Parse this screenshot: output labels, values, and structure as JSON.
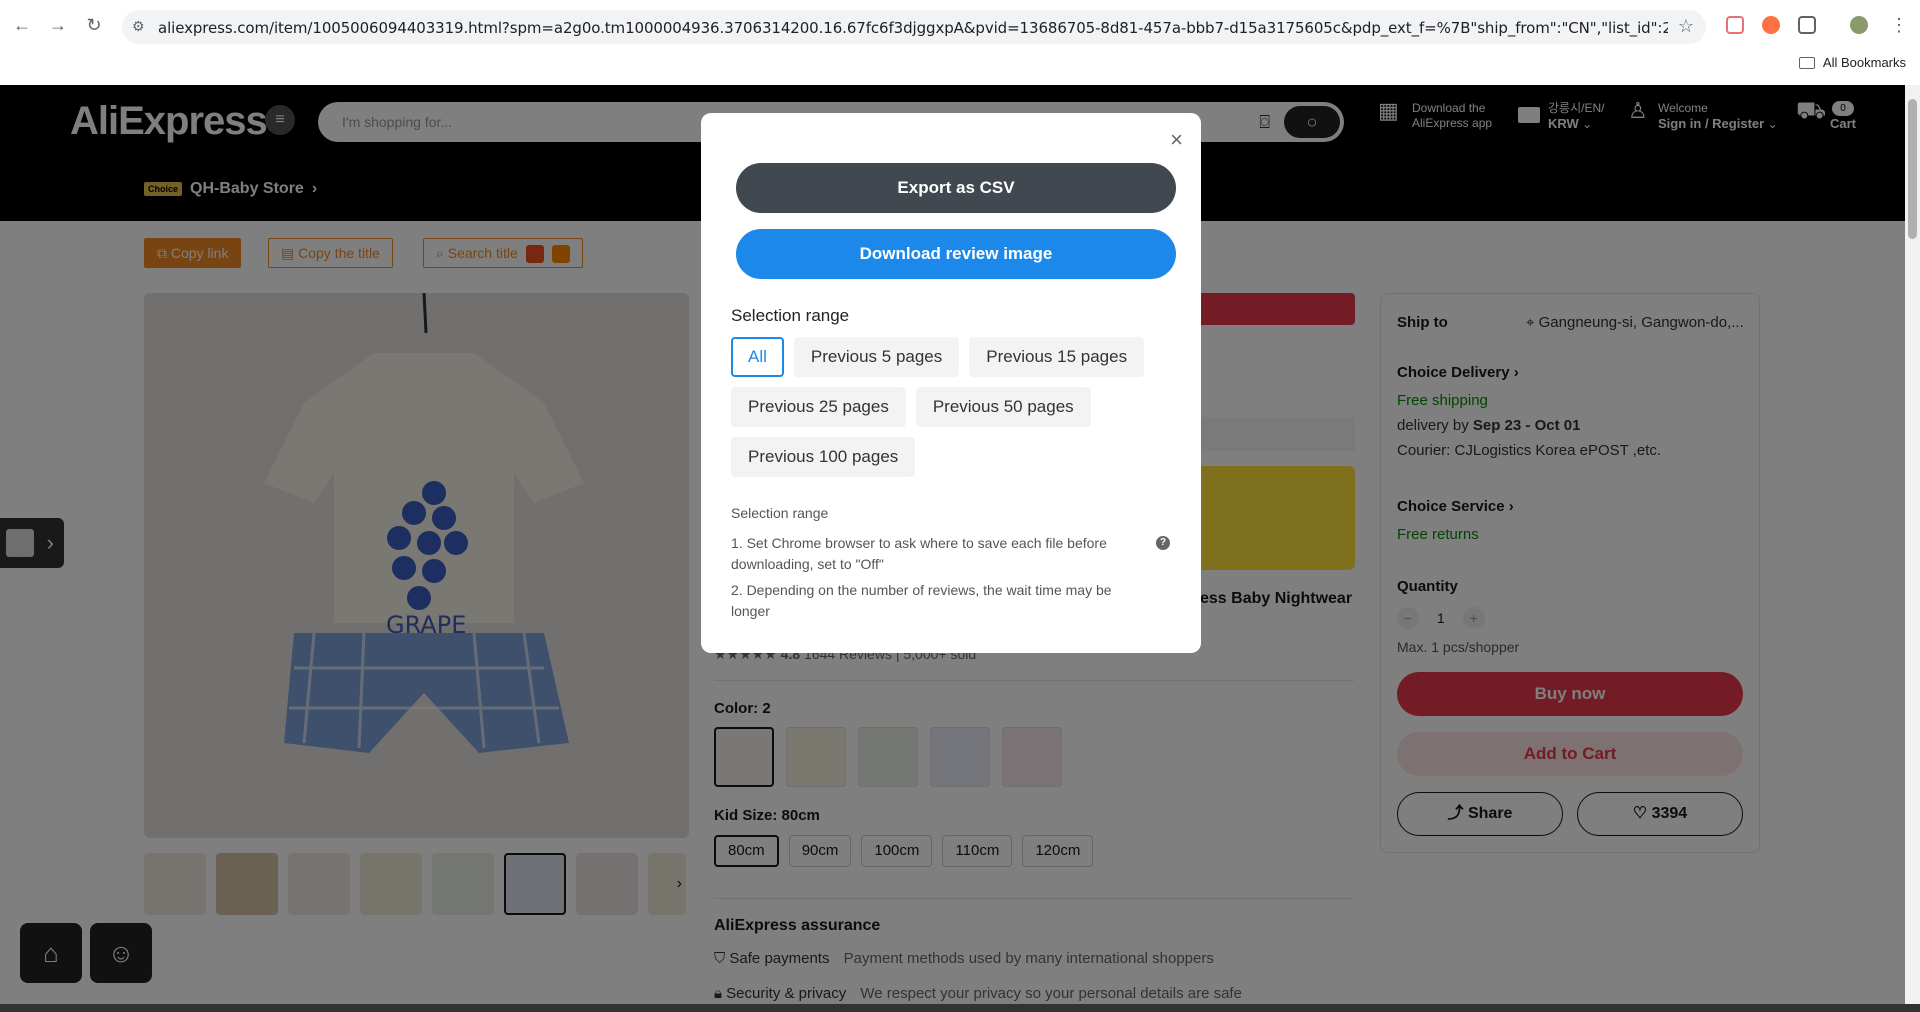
{
  "browser": {
    "url": "aliexpress.com/item/1005006094403319.html?spm=a2g0o.tm1000004936.3706314200.16.67fc6f3djggxpA&pvid=13686705-8d81-457a-bbb7-d15a3175605c&pdp_ext_f=%7B\"ship_from\":\"CN\",\"list_id\":286001,\"sku_id\":\"12000...",
    "bookmarks_label": "All Bookmarks"
  },
  "header": {
    "logo": "AliExpress",
    "search_placeholder": "I'm shopping for...",
    "app_line1": "Download the",
    "app_line2": "AliExpress app",
    "locale_line1": "강릉시/EN/",
    "locale_line2": "KRW",
    "welcome": "Welcome",
    "signin": "Sign in / Register",
    "cart_count": "0",
    "cart_label": "Cart",
    "choice_badge": "Choice",
    "store_name": "QH-Baby Store"
  },
  "toolbar": {
    "copy_link": "Copy link",
    "copy_title": "Copy the title",
    "search_title": "Search title"
  },
  "product": {
    "title_fragment": "ess Baby Nightwear",
    "rating": "4.8",
    "reviews": "1644 Reviews",
    "sold": "5,000+ sold",
    "color_label": "Color: 2",
    "size_label": "Kid Size: 80cm",
    "sizes": [
      "80cm",
      "90cm",
      "100cm",
      "110cm",
      "120cm"
    ],
    "assurance_title": "AliExpress assurance",
    "safe_payments": "Safe payments",
    "safe_payments_desc": "Payment methods used by many international shoppers",
    "security": "Security & privacy",
    "security_desc": "We respect your privacy so your personal details are safe"
  },
  "shipping": {
    "ship_to_label": "Ship to",
    "ship_to_value": "Gangneung-si, Gangwon-do,...",
    "choice_delivery": "Choice Delivery",
    "free_shipping": "Free shipping",
    "delivery_prefix": "delivery by",
    "delivery_dates": "Sep 23 - Oct 01",
    "courier_prefix": "Courier:",
    "courier_1": "CJLogistics",
    "courier_2": "Korea ePOST ,etc.",
    "choice_service": "Choice Service",
    "free_returns": "Free returns",
    "quantity_label": "Quantity",
    "quantity_value": "1",
    "max_note": "Max. 1 pcs/shopper",
    "buy_now": "Buy now",
    "add_to_cart": "Add to Cart",
    "share": "Share",
    "wishlist_count": "3394"
  },
  "modal": {
    "export_csv": "Export as CSV",
    "download_image": "Download review image",
    "range_title": "Selection range",
    "chips": [
      "All",
      "Previous 5 pages",
      "Previous 15 pages",
      "Previous 25 pages",
      "Previous 50 pages",
      "Previous 100 pages"
    ],
    "info_title": "Selection range",
    "info_1": "1. Set Chrome browser to ask where to save each file before downloading, set to \"Off\"",
    "info_2": "2. Depending on the number of reviews, the wait time may be longer"
  },
  "colors": {
    "accent_red": "#e8384b",
    "accent_blue": "#1c88ea",
    "choice_green": "#018a00",
    "csv_button": "#424850"
  }
}
